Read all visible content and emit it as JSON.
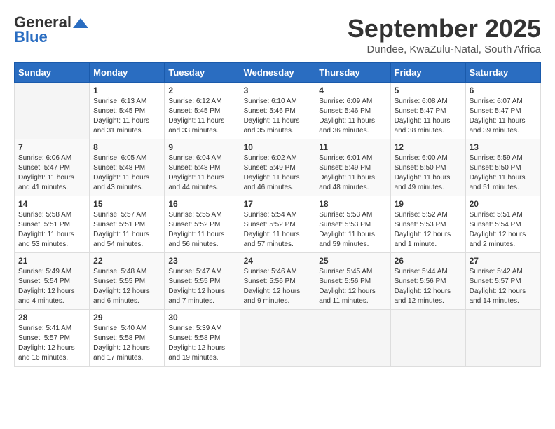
{
  "logo": {
    "text_general": "General",
    "text_blue": "Blue"
  },
  "header": {
    "month_title": "September 2025",
    "subtitle": "Dundee, KwaZulu-Natal, South Africa"
  },
  "calendar": {
    "days_of_week": [
      "Sunday",
      "Monday",
      "Tuesday",
      "Wednesday",
      "Thursday",
      "Friday",
      "Saturday"
    ],
    "weeks": [
      [
        {
          "day": "",
          "info": ""
        },
        {
          "day": "1",
          "info": "Sunrise: 6:13 AM\nSunset: 5:45 PM\nDaylight: 11 hours\nand 31 minutes."
        },
        {
          "day": "2",
          "info": "Sunrise: 6:12 AM\nSunset: 5:45 PM\nDaylight: 11 hours\nand 33 minutes."
        },
        {
          "day": "3",
          "info": "Sunrise: 6:10 AM\nSunset: 5:46 PM\nDaylight: 11 hours\nand 35 minutes."
        },
        {
          "day": "4",
          "info": "Sunrise: 6:09 AM\nSunset: 5:46 PM\nDaylight: 11 hours\nand 36 minutes."
        },
        {
          "day": "5",
          "info": "Sunrise: 6:08 AM\nSunset: 5:47 PM\nDaylight: 11 hours\nand 38 minutes."
        },
        {
          "day": "6",
          "info": "Sunrise: 6:07 AM\nSunset: 5:47 PM\nDaylight: 11 hours\nand 39 minutes."
        }
      ],
      [
        {
          "day": "7",
          "info": "Sunrise: 6:06 AM\nSunset: 5:47 PM\nDaylight: 11 hours\nand 41 minutes."
        },
        {
          "day": "8",
          "info": "Sunrise: 6:05 AM\nSunset: 5:48 PM\nDaylight: 11 hours\nand 43 minutes."
        },
        {
          "day": "9",
          "info": "Sunrise: 6:04 AM\nSunset: 5:48 PM\nDaylight: 11 hours\nand 44 minutes."
        },
        {
          "day": "10",
          "info": "Sunrise: 6:02 AM\nSunset: 5:49 PM\nDaylight: 11 hours\nand 46 minutes."
        },
        {
          "day": "11",
          "info": "Sunrise: 6:01 AM\nSunset: 5:49 PM\nDaylight: 11 hours\nand 48 minutes."
        },
        {
          "day": "12",
          "info": "Sunrise: 6:00 AM\nSunset: 5:50 PM\nDaylight: 11 hours\nand 49 minutes."
        },
        {
          "day": "13",
          "info": "Sunrise: 5:59 AM\nSunset: 5:50 PM\nDaylight: 11 hours\nand 51 minutes."
        }
      ],
      [
        {
          "day": "14",
          "info": "Sunrise: 5:58 AM\nSunset: 5:51 PM\nDaylight: 11 hours\nand 53 minutes."
        },
        {
          "day": "15",
          "info": "Sunrise: 5:57 AM\nSunset: 5:51 PM\nDaylight: 11 hours\nand 54 minutes."
        },
        {
          "day": "16",
          "info": "Sunrise: 5:55 AM\nSunset: 5:52 PM\nDaylight: 11 hours\nand 56 minutes."
        },
        {
          "day": "17",
          "info": "Sunrise: 5:54 AM\nSunset: 5:52 PM\nDaylight: 11 hours\nand 57 minutes."
        },
        {
          "day": "18",
          "info": "Sunrise: 5:53 AM\nSunset: 5:53 PM\nDaylight: 11 hours\nand 59 minutes."
        },
        {
          "day": "19",
          "info": "Sunrise: 5:52 AM\nSunset: 5:53 PM\nDaylight: 12 hours\nand 1 minute."
        },
        {
          "day": "20",
          "info": "Sunrise: 5:51 AM\nSunset: 5:54 PM\nDaylight: 12 hours\nand 2 minutes."
        }
      ],
      [
        {
          "day": "21",
          "info": "Sunrise: 5:49 AM\nSunset: 5:54 PM\nDaylight: 12 hours\nand 4 minutes."
        },
        {
          "day": "22",
          "info": "Sunrise: 5:48 AM\nSunset: 5:55 PM\nDaylight: 12 hours\nand 6 minutes."
        },
        {
          "day": "23",
          "info": "Sunrise: 5:47 AM\nSunset: 5:55 PM\nDaylight: 12 hours\nand 7 minutes."
        },
        {
          "day": "24",
          "info": "Sunrise: 5:46 AM\nSunset: 5:56 PM\nDaylight: 12 hours\nand 9 minutes."
        },
        {
          "day": "25",
          "info": "Sunrise: 5:45 AM\nSunset: 5:56 PM\nDaylight: 12 hours\nand 11 minutes."
        },
        {
          "day": "26",
          "info": "Sunrise: 5:44 AM\nSunset: 5:56 PM\nDaylight: 12 hours\nand 12 minutes."
        },
        {
          "day": "27",
          "info": "Sunrise: 5:42 AM\nSunset: 5:57 PM\nDaylight: 12 hours\nand 14 minutes."
        }
      ],
      [
        {
          "day": "28",
          "info": "Sunrise: 5:41 AM\nSunset: 5:57 PM\nDaylight: 12 hours\nand 16 minutes."
        },
        {
          "day": "29",
          "info": "Sunrise: 5:40 AM\nSunset: 5:58 PM\nDaylight: 12 hours\nand 17 minutes."
        },
        {
          "day": "30",
          "info": "Sunrise: 5:39 AM\nSunset: 5:58 PM\nDaylight: 12 hours\nand 19 minutes."
        },
        {
          "day": "",
          "info": ""
        },
        {
          "day": "",
          "info": ""
        },
        {
          "day": "",
          "info": ""
        },
        {
          "day": "",
          "info": ""
        }
      ]
    ]
  }
}
